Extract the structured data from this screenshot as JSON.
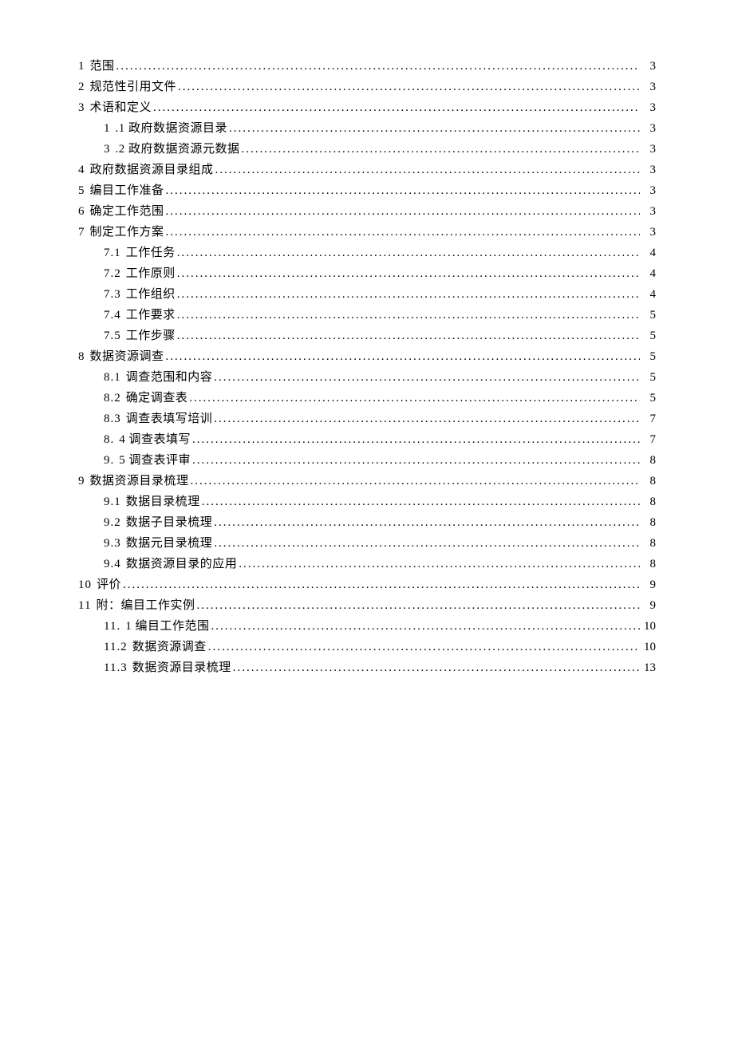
{
  "toc": [
    {
      "level": 1,
      "num": "1",
      "title": "范围",
      "page": "3"
    },
    {
      "level": 1,
      "num": "2",
      "title": "规范性引用文件",
      "page": "3"
    },
    {
      "level": 1,
      "num": "3",
      "title": "术语和定义",
      "page": "3"
    },
    {
      "level": 2,
      "num": "1",
      "title": ".1 政府数据资源目录",
      "page": "3"
    },
    {
      "level": 2,
      "num": "3",
      "title": ".2 政府数据资源元数据",
      "page": "3"
    },
    {
      "level": 1,
      "num": "4",
      "title": "政府数据资源目录组成",
      "page": "3"
    },
    {
      "level": 1,
      "num": "5",
      "title": "编目工作准备",
      "page": "3"
    },
    {
      "level": 1,
      "num": "6",
      "title": "确定工作范围",
      "page": "3"
    },
    {
      "level": 1,
      "num": "7",
      "title": "制定工作方案",
      "page": "3"
    },
    {
      "level": 2,
      "num": "7.1",
      "title": "工作任务",
      "page": "4"
    },
    {
      "level": 2,
      "num": "7.2",
      "title": "工作原则",
      "page": "4"
    },
    {
      "level": 2,
      "num": "7.3",
      "title": "工作组织",
      "page": "4"
    },
    {
      "level": 2,
      "num": "7.4",
      "title": "工作要求",
      "page": "5"
    },
    {
      "level": 2,
      "num": "7.5",
      "title": "工作步骤",
      "page": "5"
    },
    {
      "level": 1,
      "num": "8",
      "title": "数据资源调查",
      "page": "5"
    },
    {
      "level": 2,
      "num": "8.1",
      "title": "调查范围和内容",
      "page": "5"
    },
    {
      "level": 2,
      "num": "8.2",
      "title": "确定调查表",
      "page": "5"
    },
    {
      "level": 2,
      "num": "8.3",
      "title": "调查表填写培训",
      "page": "7"
    },
    {
      "level": 2,
      "num": "8.",
      "title": " 4 调查表填写 ",
      "page": "7"
    },
    {
      "level": 2,
      "num": "9.",
      "title": " 5 调查表评审 ",
      "page": "8"
    },
    {
      "level": 1,
      "num": "9",
      "title": "数据资源目录梳理",
      "page": "8"
    },
    {
      "level": 2,
      "num": "9.1",
      "title": "  数据目录梳理 ",
      "page": "8"
    },
    {
      "level": 2,
      "num": "9.2",
      "title": "  数据子目录梳理 ",
      "page": "8"
    },
    {
      "level": 2,
      "num": "9.3",
      "title": "  数据元目录梳理 ",
      "page": "8"
    },
    {
      "level": 2,
      "num": "9.4",
      "title": "  数据资源目录的应用 ",
      "page": "8"
    },
    {
      "level": 1,
      "num": "10",
      "title": "评价",
      "page": "9"
    },
    {
      "level": 1,
      "num": "11",
      "title": "附：编目工作实例",
      "page": "9"
    },
    {
      "level": 2,
      "num": "11.",
      "title": " 1 编目工作范围 ",
      "page": "10"
    },
    {
      "level": 2,
      "num": "11.2",
      "title": "  数据资源调查 ",
      "page": "10"
    },
    {
      "level": 2,
      "num": "11.3",
      "title": "  数据资源目录梳理 ",
      "page": "13"
    }
  ],
  "dots": "...................................................................................................................................................................."
}
